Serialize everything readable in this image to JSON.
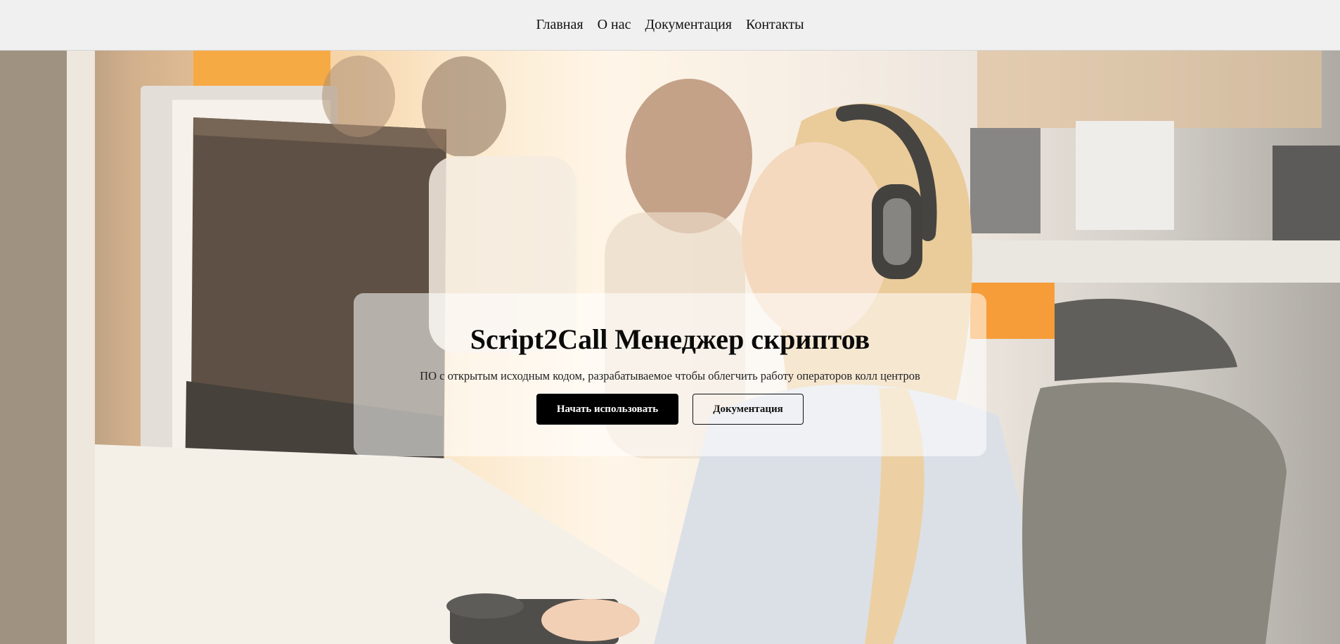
{
  "nav": {
    "items": [
      {
        "label": "Главная"
      },
      {
        "label": "О нас"
      },
      {
        "label": "Документация"
      },
      {
        "label": "Контакты"
      }
    ]
  },
  "hero": {
    "title": "Script2Call Менеджер скриптов",
    "subtitle": "ПО с открытым исходным кодом, разрабатываемое чтобы облегчить работу операторов колл центров",
    "primary_button": "Начать использовать",
    "secondary_button": "Документация",
    "background_image": "call-center-operator-photo"
  },
  "colors": {
    "nav_background": "#f0f0f0",
    "primary_button": "#000000",
    "accent_orange": "#f59a22"
  }
}
